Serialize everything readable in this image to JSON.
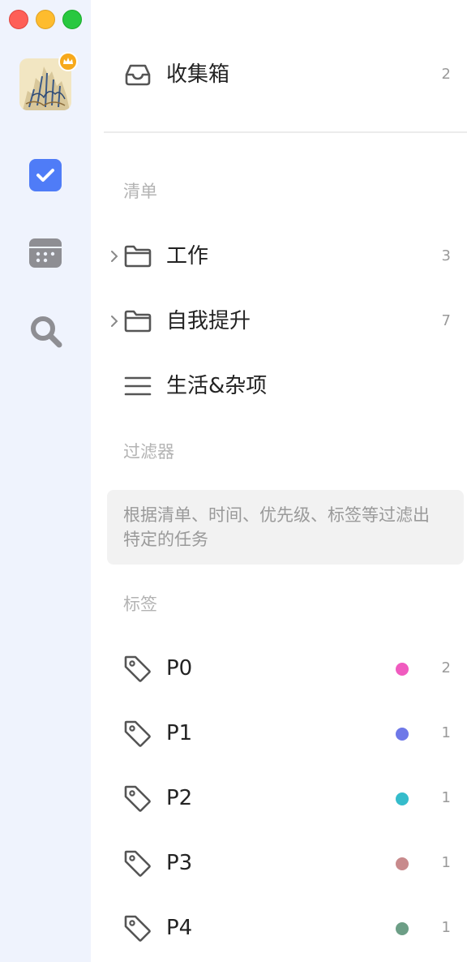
{
  "window": {
    "traffic_lights": [
      "close",
      "minimize",
      "zoom"
    ]
  },
  "sidebar_rail": {
    "avatar": "user-avatar",
    "badge": "crown-icon",
    "items": [
      {
        "icon": "checkbox-icon",
        "active": true
      },
      {
        "icon": "calendar-icon",
        "active": false
      },
      {
        "icon": "search-icon",
        "active": false
      }
    ]
  },
  "inbox": {
    "label": "收集箱",
    "count": "2",
    "icon": "inbox-icon"
  },
  "lists_section": {
    "title": "清单",
    "items": [
      {
        "label": "工作",
        "count": "3",
        "icon": "folder-icon",
        "expandable": true
      },
      {
        "label": "自我提升",
        "count": "7",
        "icon": "folder-icon",
        "expandable": true
      },
      {
        "label": "生活&杂项",
        "count": "",
        "icon": "list-icon",
        "expandable": false
      }
    ]
  },
  "filters_section": {
    "title": "过滤器",
    "description": "根据清单、时间、优先级、标签等过滤出特定的任务"
  },
  "tags_section": {
    "title": "标签",
    "items": [
      {
        "label": "P0",
        "count": "2",
        "color": "#f05bbf"
      },
      {
        "label": "P1",
        "count": "1",
        "color": "#6e78e8"
      },
      {
        "label": "P2",
        "count": "1",
        "color": "#35bccb"
      },
      {
        "label": "P3",
        "count": "1",
        "color": "#c88a8c"
      },
      {
        "label": "P4",
        "count": "1",
        "color": "#6c9e86"
      }
    ]
  },
  "colors": {
    "rail_bg": "#eff3fd",
    "accent": "#4f7cf7",
    "icon_gray": "#8e8e93"
  }
}
